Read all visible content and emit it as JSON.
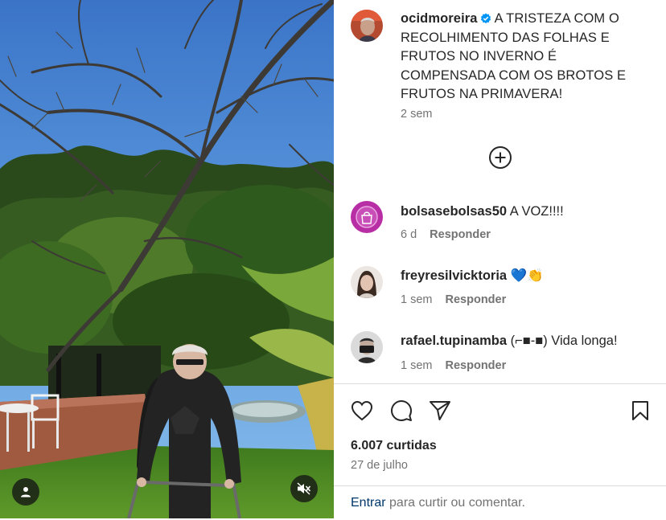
{
  "post": {
    "author": "ocidmoreira",
    "caption": "A TRISTEZA COM O RECOLHIMENTO DAS FOLHAS E FRUTOS NO INVERNO É COMPENSADA COM OS BROTOS E FRUTOS NA PRIMAVERA!",
    "time": "2 sem",
    "likes": "6.007 curtidas",
    "date": "27 de julho"
  },
  "comments": [
    {
      "username": "bolsasebolsas50",
      "text": "A VOZ!!!!",
      "time": "6 d",
      "reply_label": "Responder"
    },
    {
      "username": "freyresilvicktoria",
      "text": "💙👏",
      "time": "1 sem",
      "reply_label": "Responder"
    },
    {
      "username": "rafael.tupinamba",
      "text": "(⌐■-■) Vida longa!",
      "time": "1 sem",
      "reply_label": "Responder"
    }
  ],
  "footer": {
    "login_link": "Entrar",
    "login_text": " para curtir ou comentar."
  },
  "icons": {
    "verified": "verified-badge-icon",
    "load_more": "plus-circle-icon",
    "like": "heart-icon",
    "comment": "speech-bubble-icon",
    "share": "paper-plane-icon",
    "save": "bookmark-icon",
    "user_tag": "person-icon",
    "mute": "speaker-muted-icon"
  },
  "colors": {
    "text": "#262626",
    "secondary": "#737373",
    "verified": "#0095f6",
    "link": "#00376b",
    "divider": "#dbdbdb"
  }
}
